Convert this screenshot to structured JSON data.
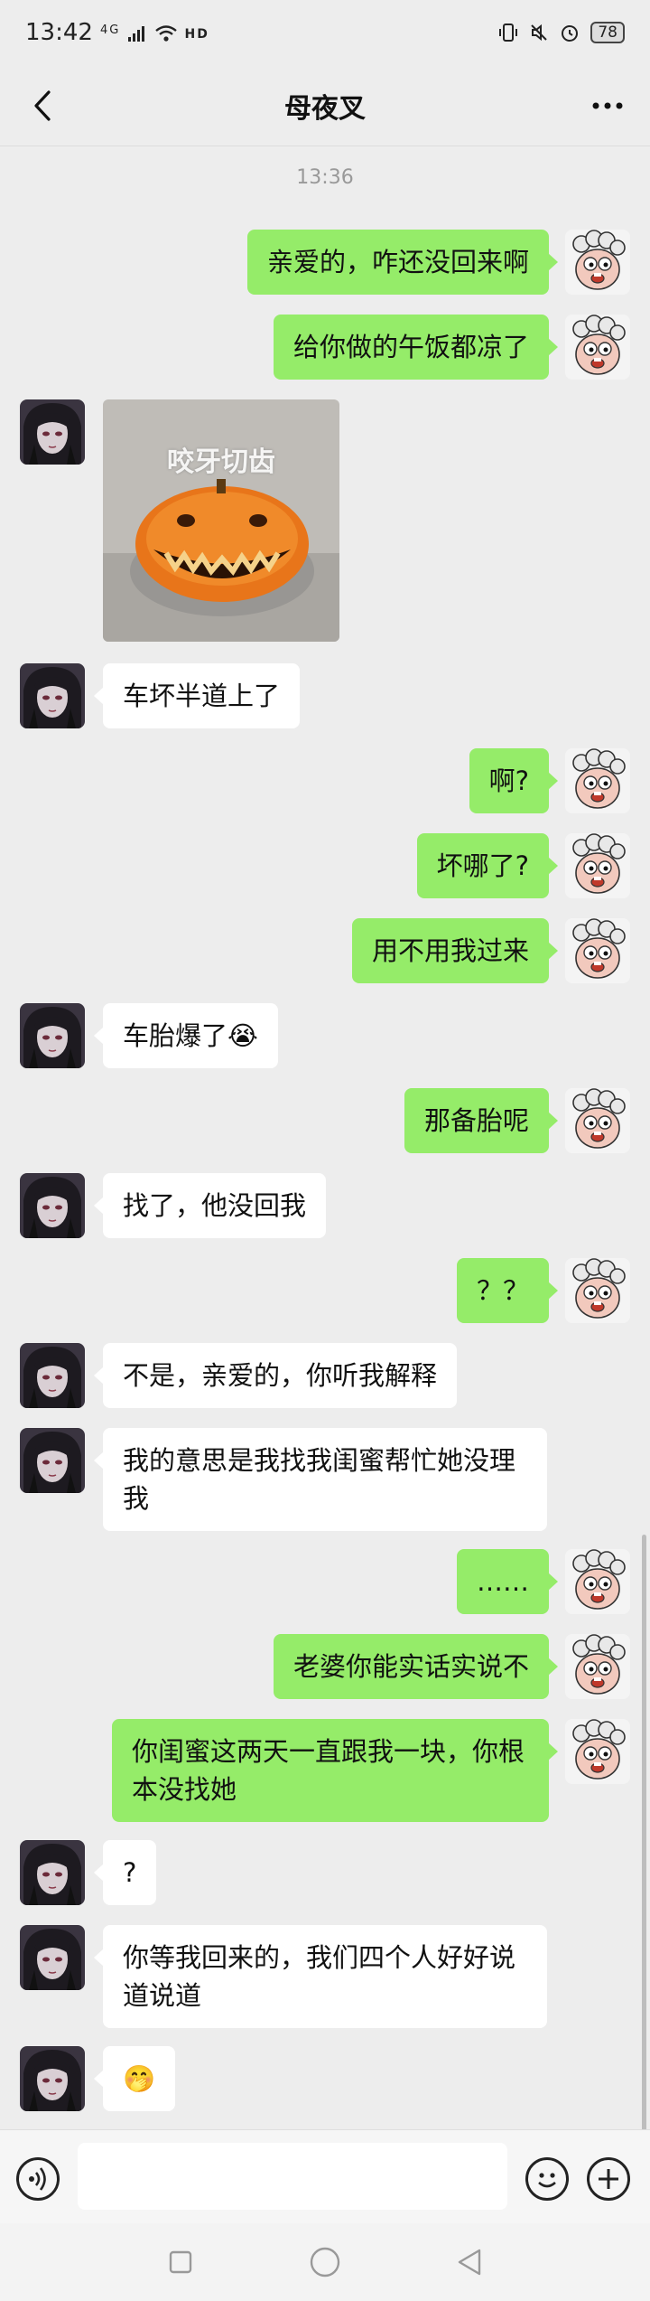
{
  "status_bar": {
    "time": "13:42",
    "network": "4G",
    "hd": "HD",
    "battery": "78"
  },
  "header": {
    "title": "母夜叉"
  },
  "chat": {
    "timestamp": "13:36",
    "messages": [
      {
        "side": "right",
        "text": "亲爱的，咋还没回来啊"
      },
      {
        "side": "right",
        "text": "给你做的午饭都凉了"
      },
      {
        "side": "left",
        "sticker_caption": "咬牙切齿"
      },
      {
        "side": "left",
        "text": "车坏半道上了"
      },
      {
        "side": "right",
        "text": "啊?"
      },
      {
        "side": "right",
        "text": "坏哪了?"
      },
      {
        "side": "right",
        "text": "用不用我过来"
      },
      {
        "side": "left",
        "text": "车胎爆了😭"
      },
      {
        "side": "right",
        "text": "那备胎呢"
      },
      {
        "side": "left",
        "text": "找了，他没回我"
      },
      {
        "side": "right",
        "text": "？？"
      },
      {
        "side": "left",
        "text": "不是，亲爱的，你听我解释"
      },
      {
        "side": "left",
        "text": "我的意思是我找我闺蜜帮忙她没理我"
      },
      {
        "side": "right",
        "text": "……"
      },
      {
        "side": "right",
        "text": "老婆你能实话实说不"
      },
      {
        "side": "right",
        "text": "你闺蜜这两天一直跟我一块，你根本没找她"
      },
      {
        "side": "left",
        "text": "?"
      },
      {
        "side": "left",
        "text": "你等我回来的，我们四个人好好说道说道"
      },
      {
        "side": "left",
        "text": "🤭"
      }
    ]
  },
  "input": {
    "placeholder": ""
  },
  "colors": {
    "background": "#ededed",
    "sent_bubble": "#95ec69",
    "received_bubble": "#ffffff"
  },
  "icons": {
    "back": "back-arrow-icon",
    "more": "more-dots-icon",
    "voice": "voice-icon",
    "emoji": "emoji-icon",
    "plus": "plus-icon"
  }
}
